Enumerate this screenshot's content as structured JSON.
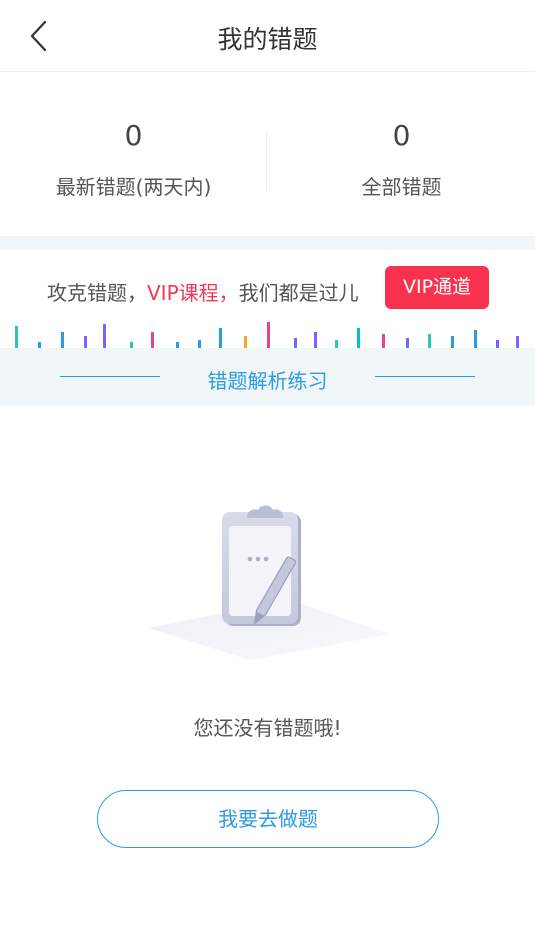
{
  "header": {
    "title": "我的错题"
  },
  "stats": [
    {
      "count": "0",
      "label": "最新错题(两天内)"
    },
    {
      "count": "0",
      "label": "全部错题"
    }
  ],
  "promo": {
    "text_before": "攻克错题，",
    "highlight": "VIP课程，",
    "text_after": "我们都是过儿",
    "vip_button": "VIP通道",
    "highlight_color": "#ee3a56",
    "button_color": "#f9324f"
  },
  "practice": {
    "label": "错题解析练习",
    "color": "#2b9be4"
  },
  "empty": {
    "message": "您还没有错题哦!",
    "icon": "clipboard-pencil-illustration"
  },
  "action": {
    "button_label": "我要去做题"
  }
}
